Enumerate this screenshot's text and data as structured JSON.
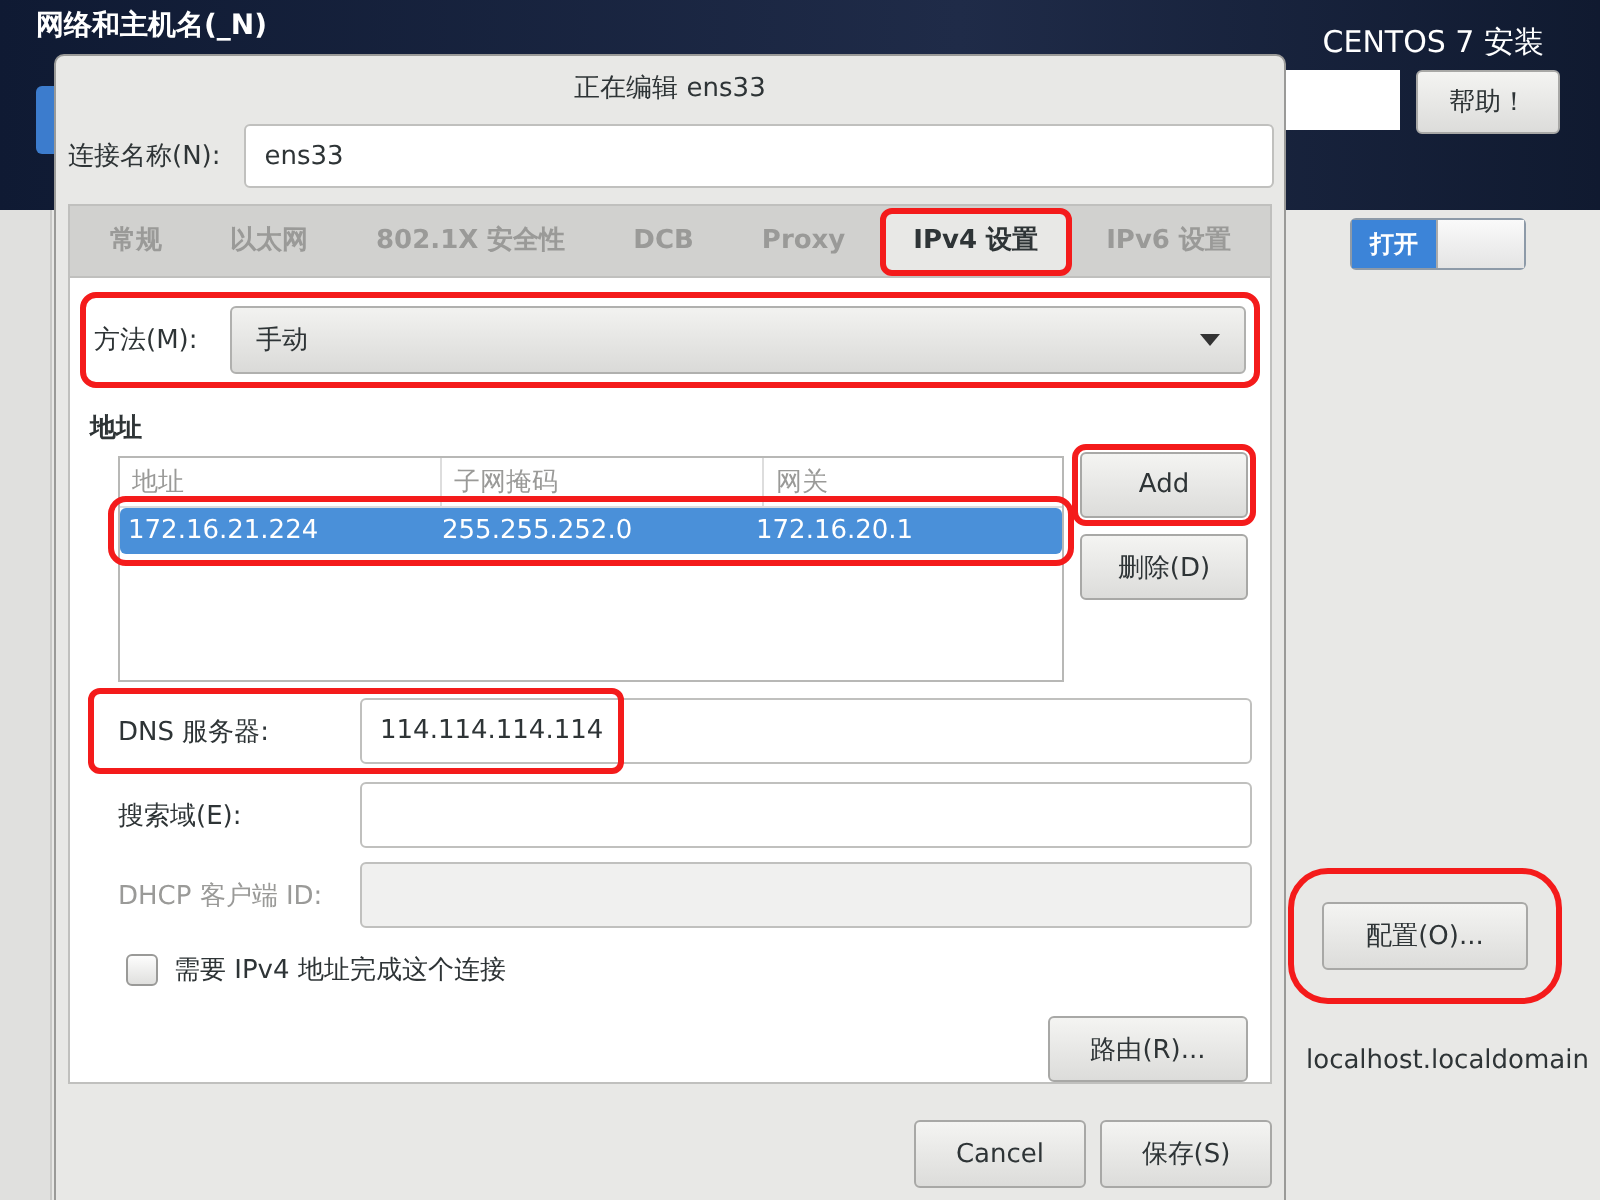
{
  "background": {
    "section_title": "网络和主机名(_N)",
    "product": "CENTOS 7 安装",
    "help_button": "帮助！",
    "switch": {
      "label": "打开",
      "on": true
    },
    "configure_button": {
      "label": "配置(O)...",
      "highlighted": true
    },
    "hostname": "localhost.localdomain"
  },
  "dialog": {
    "title": "正在编辑 ens33",
    "connection_name": {
      "label": "连接名称(N):",
      "value": "ens33"
    },
    "tabs": [
      {
        "label": "常规",
        "selected": false,
        "highlighted": false
      },
      {
        "label": "以太网",
        "selected": false,
        "highlighted": false
      },
      {
        "label": "802.1X 安全性",
        "selected": false,
        "highlighted": false
      },
      {
        "label": "DCB",
        "selected": false,
        "highlighted": false
      },
      {
        "label": "Proxy",
        "selected": false,
        "highlighted": false
      },
      {
        "label": "IPv4 设置",
        "selected": true,
        "highlighted": true
      },
      {
        "label": "IPv6 设置",
        "selected": false,
        "highlighted": false
      }
    ],
    "method": {
      "label": "方法(M):",
      "value": "手动",
      "highlighted": true
    },
    "addresses": {
      "heading": "地址",
      "columns": [
        "地址",
        "子网掩码",
        "网关"
      ],
      "rows": [
        {
          "cells": [
            "172.16.21.224",
            "255.255.252.0",
            "172.16.20.1"
          ],
          "selected": true,
          "highlighted": true
        }
      ]
    },
    "address_buttons": [
      {
        "label": "Add",
        "highlighted": true
      },
      {
        "label": "删除(D)",
        "highlighted": false
      }
    ],
    "fields": [
      {
        "label": "DNS 服务器:",
        "value": "114.114.114.114",
        "disabled": false,
        "highlighted": true
      },
      {
        "label": "搜索域(E):",
        "disabled": false,
        "highlighted": false
      },
      {
        "label": "DHCP 客户端 ID:",
        "disabled": true,
        "highlighted": false
      }
    ],
    "require_ipv4": {
      "label": "需要 IPv4 地址完成这个连接",
      "checked": false
    },
    "routes_button": "路由(R)...",
    "buttons": [
      "Cancel",
      "保存(S)"
    ]
  }
}
